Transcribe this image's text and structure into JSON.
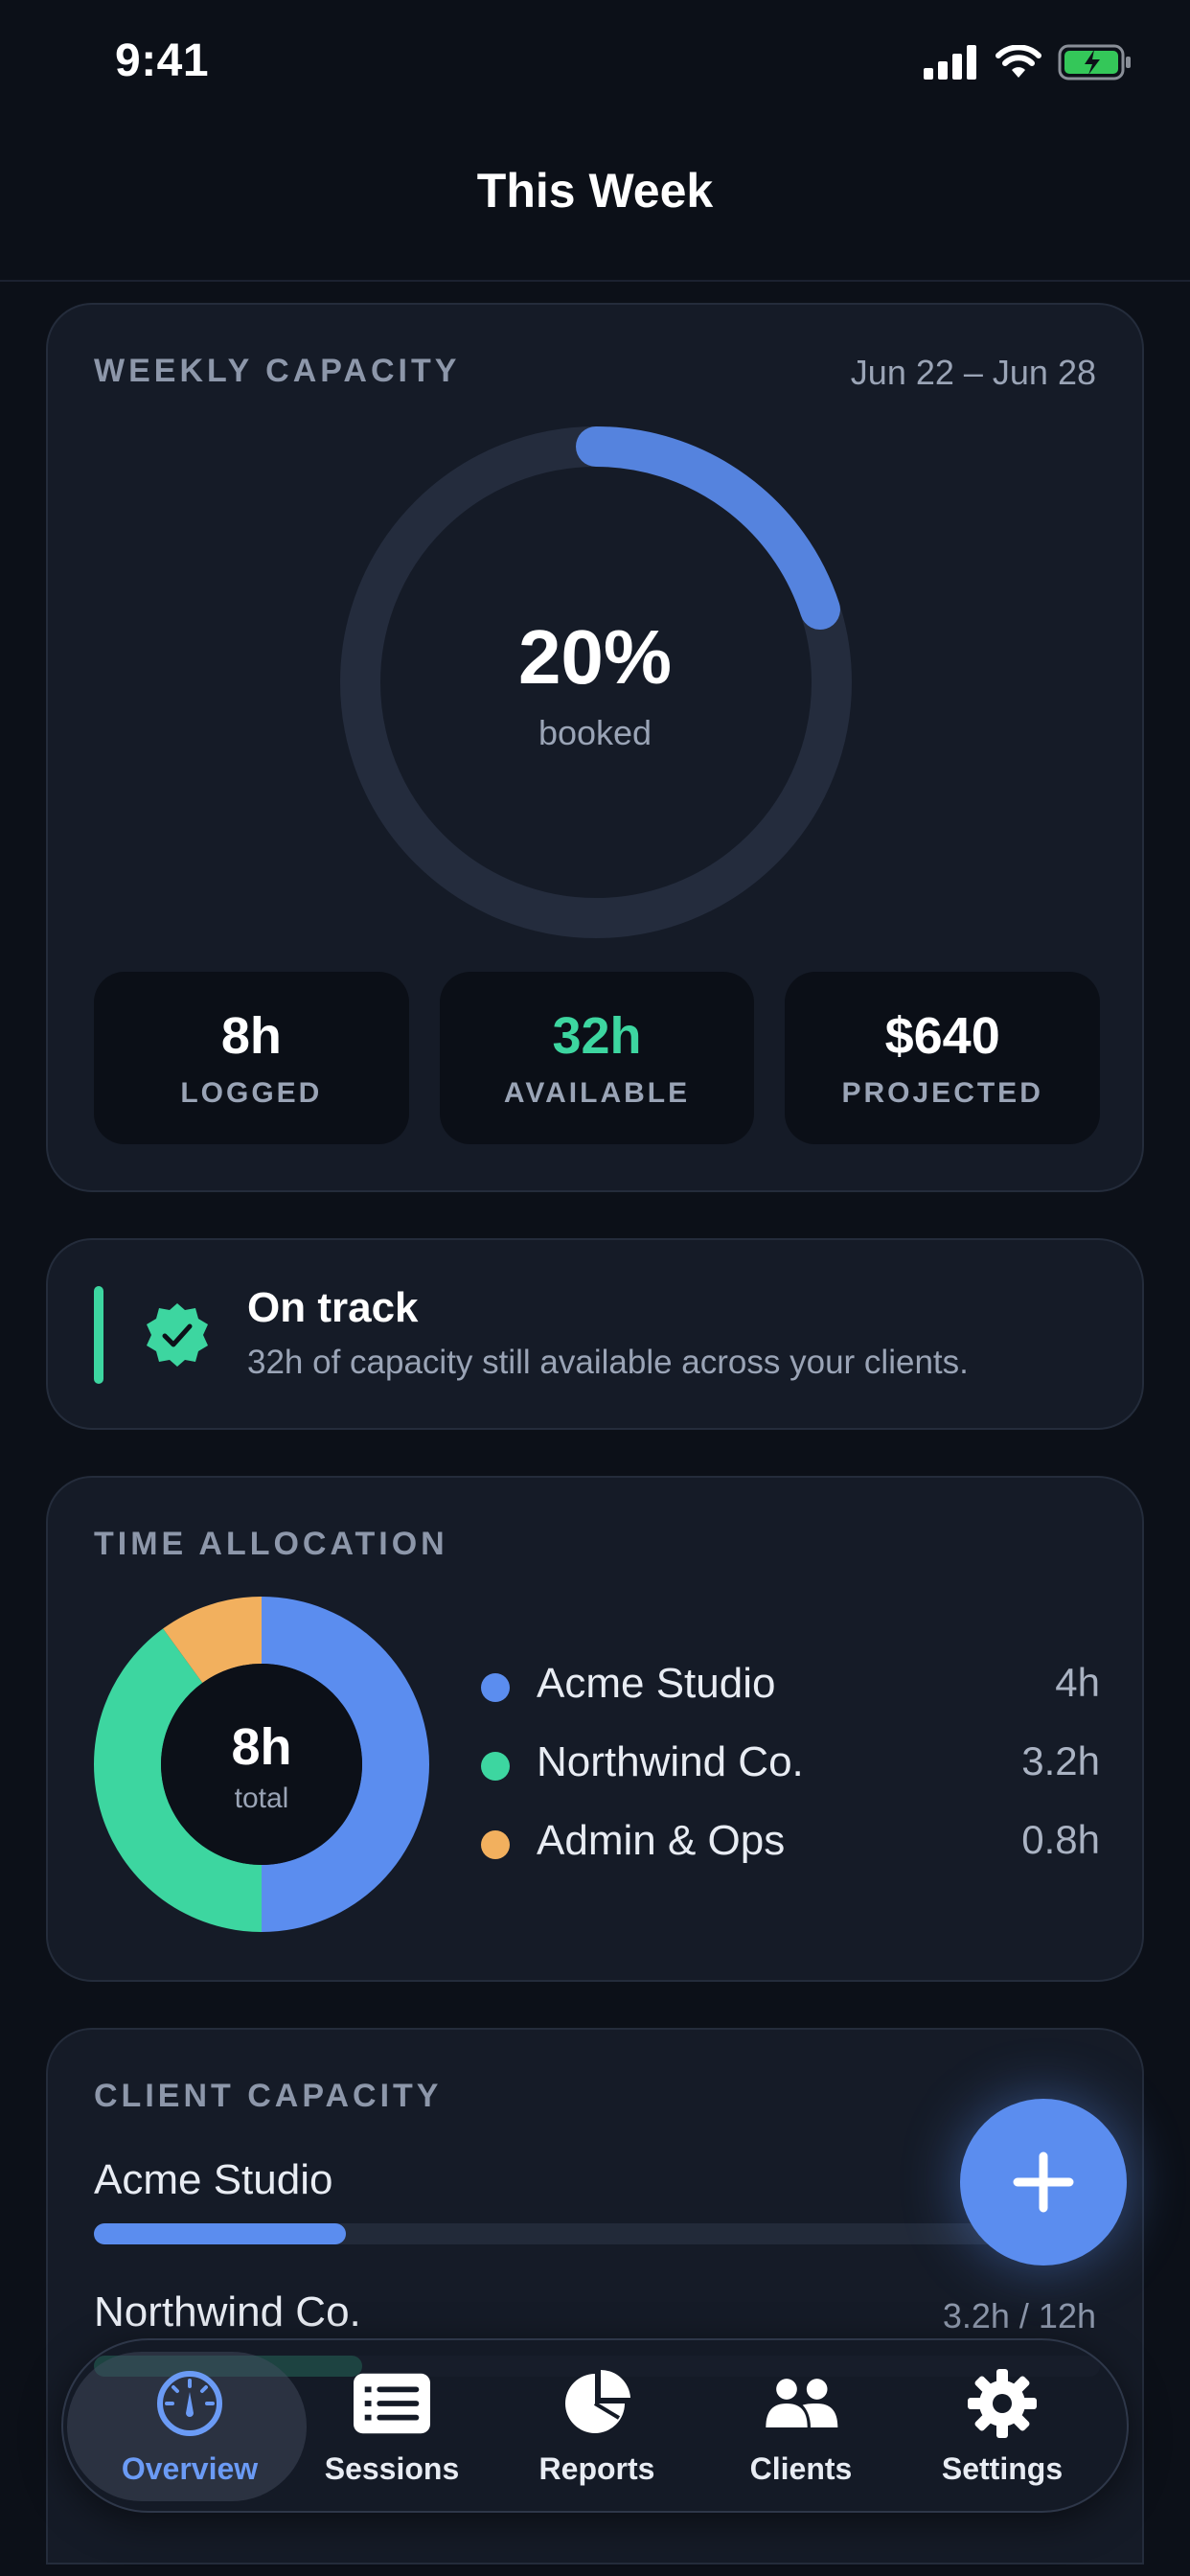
{
  "status_bar": {
    "time": "9:41"
  },
  "header": {
    "title": "This Week"
  },
  "weekly_capacity": {
    "label": "WEEKLY CAPACITY",
    "dates": "Jun 22 – Jun 28",
    "percent_text": "20%",
    "percent_value": 0.2,
    "percent_sub": "booked",
    "stats": [
      {
        "value": "8h",
        "label": "LOGGED",
        "color": "#ffffff"
      },
      {
        "value": "32h",
        "label": "AVAILABLE",
        "color": "#3dd6a0"
      },
      {
        "value": "$640",
        "label": "PROJECTED",
        "color": "#ffffff"
      }
    ]
  },
  "status_card": {
    "title": "On track",
    "description": "32h of capacity still available across your clients.",
    "accent": "#3dd6a0"
  },
  "time_allocation": {
    "label": "TIME ALLOCATION",
    "total": "8h",
    "total_sub": "total",
    "items": [
      {
        "name": "Acme Studio",
        "value": "4h",
        "hours": 4,
        "color": "#5b8def"
      },
      {
        "name": "Northwind Co.",
        "value": "3.2h",
        "hours": 3.2,
        "color": "#3dd6a0"
      },
      {
        "name": "Admin & Ops",
        "value": "0.8h",
        "hours": 0.8,
        "color": "#f2b05e"
      }
    ]
  },
  "client_capacity": {
    "label": "CLIENT CAPACITY",
    "clients": [
      {
        "name": "Acme Studio",
        "value": "",
        "fill": 0.25,
        "color": "#5b8def"
      },
      {
        "name": "Northwind Co.",
        "value": "3.2h / 12h",
        "fill": 0.267,
        "color": "#3dd6a0"
      }
    ]
  },
  "fab": {
    "icon": "plus-icon"
  },
  "tabs": [
    {
      "label": "Overview",
      "icon": "gauge-icon",
      "active": true
    },
    {
      "label": "Sessions",
      "icon": "list-icon",
      "active": false
    },
    {
      "label": "Reports",
      "icon": "pie-chart-icon",
      "active": false
    },
    {
      "label": "Clients",
      "icon": "people-icon",
      "active": false
    },
    {
      "label": "Settings",
      "icon": "gear-icon",
      "active": false
    }
  ],
  "colors": {
    "accent": "#5b8def",
    "success": "#3dd6a0",
    "warning": "#f2b05e",
    "background": "#0c1018",
    "card": "#151b27"
  }
}
